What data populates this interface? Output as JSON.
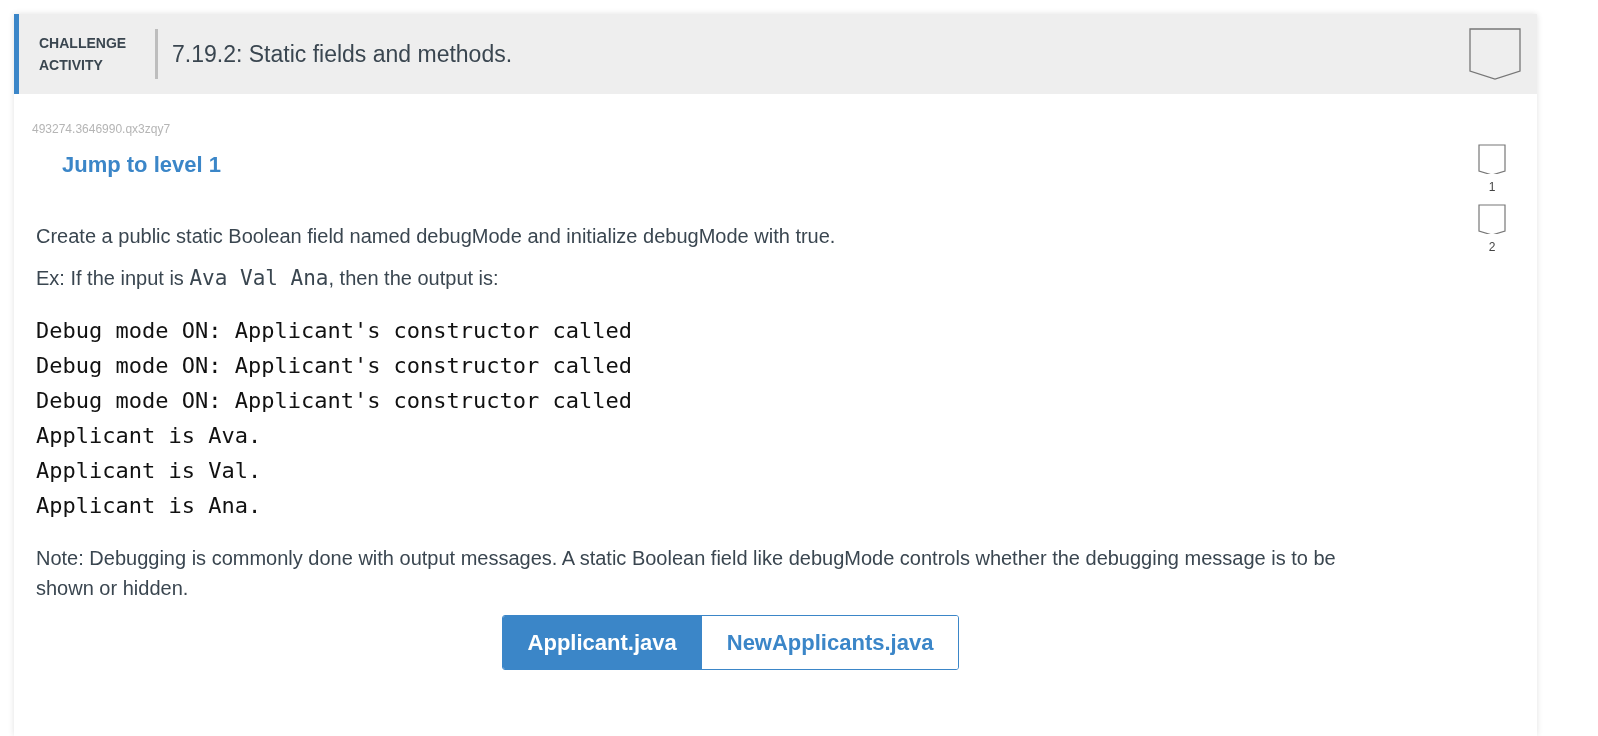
{
  "header": {
    "kind_label": "CHALLENGE ACTIVITY",
    "title": "7.19.2: Static fields and methods."
  },
  "activity_id": "493274.3646990.qx3zqy7",
  "jump_link": "Jump to level 1",
  "levels": [
    {
      "label": "1"
    },
    {
      "label": "2"
    }
  ],
  "instructions": "Create a public static Boolean field named debugMode and initialize debugMode with true.",
  "example": {
    "prefix": "Ex: If the input is ",
    "input": "Ava Val Ana",
    "suffix": ", then the output is:"
  },
  "output_lines": [
    "Debug mode ON: Applicant's constructor called",
    "Debug mode ON: Applicant's constructor called",
    "Debug mode ON: Applicant's constructor called",
    "Applicant is Ava.",
    "Applicant is Val.",
    "Applicant is Ana."
  ],
  "note": "Note: Debugging is commonly done with output messages. A static Boolean field like debugMode controls whether the debugging message is to be shown or hidden.",
  "file_tabs": [
    {
      "label": "Applicant.java",
      "selected": true
    },
    {
      "label": "NewApplicants.java",
      "selected": false
    }
  ]
}
